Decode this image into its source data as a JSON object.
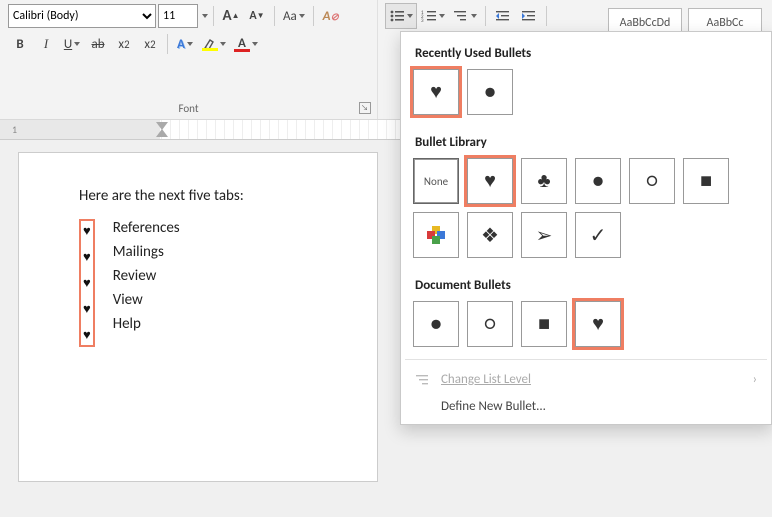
{
  "ribbon": {
    "font_group": {
      "label": "Font",
      "font_name": "Calibri (Body)",
      "font_size": "11",
      "bold": "B",
      "italic": "I",
      "underline": "U",
      "strike": "ab",
      "subscript": "x",
      "subscript_sub": "2",
      "superscript": "x",
      "superscript_sup": "2",
      "change_case": "Aa",
      "grow": "A",
      "shrink": "A",
      "text_effects": "A",
      "highlight_color": "#ffff00",
      "font_color": "#d22"
    },
    "paragraph": {
      "indent_dec": true,
      "indent_inc": true
    },
    "styles_peek": [
      "AaBbCcDd",
      "AaBbCc"
    ]
  },
  "document": {
    "intro": "Here are the next five tabs:",
    "items": [
      "References",
      "Mailings",
      "Review",
      "View",
      "Help"
    ],
    "bullet_char": "♥"
  },
  "bullet_panel": {
    "sections": {
      "recent": "Recently Used Bullets",
      "library": "Bullet Library",
      "doc": "Document Bullets"
    },
    "recent": [
      "heart",
      "disc"
    ],
    "library": [
      "none",
      "heart",
      "club",
      "disc",
      "ring",
      "square",
      "fourcolor",
      "fourdiamond",
      "arrow",
      "check"
    ],
    "doc": [
      "disc",
      "ring",
      "square",
      "heart"
    ],
    "none_label": "None",
    "change_level": "Change List Level",
    "define_new": "Define New Bullet..."
  },
  "ruler": {
    "mark1": "1"
  }
}
